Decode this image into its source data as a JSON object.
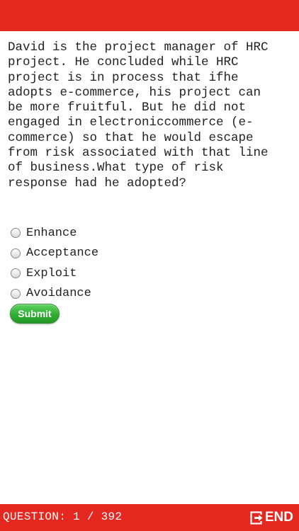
{
  "question": {
    "text": "David is the project manager of HRC\nproject. He concluded while HRC\nproject is in process that ifhe\nadopts e-commerce, his project can\nbe more fruitful. But he did not\nengaged in electroniccommerce (e-\ncommerce) so that he would escape\nfrom risk associated with that line\nof business.What type of risk\nresponse had he adopted?"
  },
  "options": [
    {
      "label": "Enhance"
    },
    {
      "label": "Acceptance"
    },
    {
      "label": "Exploit"
    },
    {
      "label": "Avoidance"
    }
  ],
  "submit_label": "Submit",
  "footer": {
    "counter": "QUESTION: 1 / 392",
    "end_label": "END",
    "end_icon": "exit-icon"
  },
  "colors": {
    "bar": "#e4271f",
    "submit": "#2fae33"
  }
}
